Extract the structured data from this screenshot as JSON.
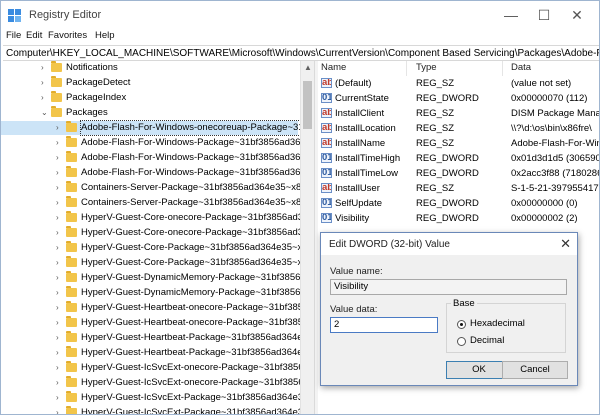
{
  "window": {
    "title": "Registry Editor"
  },
  "window_controls": {
    "minimize": "—",
    "maximize": "☐",
    "close": "✕"
  },
  "menu": [
    "File",
    "Edit",
    "Favorites",
    "Help"
  ],
  "address": "Computer\\HKEY_LOCAL_MACHINE\\SOFTWARE\\Microsoft\\Windows\\CurrentVersion\\Component Based Servicing\\Packages\\Adobe-Flash-For-Wi",
  "tree": [
    {
      "label": "Notifications",
      "level": 1,
      "arrow": "›"
    },
    {
      "label": "PackageDetect",
      "level": 1,
      "arrow": "›"
    },
    {
      "label": "PackageIndex",
      "level": 1,
      "arrow": "›"
    },
    {
      "label": "Packages",
      "level": 1,
      "arrow": "⌄"
    },
    {
      "label": "Adobe-Flash-For-Windows-onecoreuap-Package~31",
      "level": 2,
      "arrow": "›",
      "selected": true
    },
    {
      "label": "Adobe-Flash-For-Windows-Package~31bf3856ad364",
      "level": 2,
      "arrow": "›"
    },
    {
      "label": "Adobe-Flash-For-Windows-Package~31bf3856ad364",
      "level": 2,
      "arrow": "›"
    },
    {
      "label": "Adobe-Flash-For-Windows-Package~31bf3856ad364",
      "level": 2,
      "arrow": "›"
    },
    {
      "label": "Containers-Server-Package~31bf3856ad364e35~x86",
      "level": 2,
      "arrow": "›"
    },
    {
      "label": "Containers-Server-Package~31bf3856ad364e35~x86",
      "level": 2,
      "arrow": "›"
    },
    {
      "label": "HyperV-Guest-Core-onecore-Package~31bf3856ad36",
      "level": 2,
      "arrow": "›"
    },
    {
      "label": "HyperV-Guest-Core-onecore-Package~31bf3856ad36",
      "level": 2,
      "arrow": "›"
    },
    {
      "label": "HyperV-Guest-Core-Package~31bf3856ad364e35~x8t",
      "level": 2,
      "arrow": "›"
    },
    {
      "label": "HyperV-Guest-Core-Package~31bf3856ad364e35~x8t",
      "level": 2,
      "arrow": "›"
    },
    {
      "label": "HyperV-Guest-DynamicMemory-Package~31bf3856ad",
      "level": 2,
      "arrow": "›"
    },
    {
      "label": "HyperV-Guest-DynamicMemory-Package~31bf3856ad",
      "level": 2,
      "arrow": "›"
    },
    {
      "label": "HyperV-Guest-Heartbeat-onecore-Package~31bf385",
      "level": 2,
      "arrow": "›"
    },
    {
      "label": "HyperV-Guest-Heartbeat-onecore-Package~31bf385",
      "level": 2,
      "arrow": "›"
    },
    {
      "label": "HyperV-Guest-Heartbeat-Package~31bf3856ad364e3",
      "level": 2,
      "arrow": "›"
    },
    {
      "label": "HyperV-Guest-Heartbeat-Package~31bf3856ad364e3",
      "level": 2,
      "arrow": "›"
    },
    {
      "label": "HyperV-Guest-IcSvcExt-onecore-Package~31bf3856a",
      "level": 2,
      "arrow": "›"
    },
    {
      "label": "HyperV-Guest-IcSvcExt-onecore-Package~31bf3856a",
      "level": 2,
      "arrow": "›"
    },
    {
      "label": "HyperV-Guest-IcSvcExt-Package~31bf3856ad364e35",
      "level": 2,
      "arrow": "›"
    },
    {
      "label": "HyperV-Guest-IcSvcExt-Package~31bf3856ad364e35",
      "level": 2,
      "arrow": "›"
    }
  ],
  "list": {
    "headers": [
      "Name",
      "Type",
      "Data"
    ],
    "rows": [
      {
        "name": "(Default)",
        "type": "REG_SZ",
        "data": "(value not set)",
        "icon": "string-value-icon"
      },
      {
        "name": "CurrentState",
        "type": "REG_DWORD",
        "data": "0x00000070 (112)",
        "icon": "binary-value-icon"
      },
      {
        "name": "InstallClient",
        "type": "REG_SZ",
        "data": "DISM Package Manag",
        "icon": "string-value-icon"
      },
      {
        "name": "InstallLocation",
        "type": "REG_SZ",
        "data": "\\\\?\\d:\\os\\bin\\x86fre\\",
        "icon": "string-value-icon"
      },
      {
        "name": "InstallName",
        "type": "REG_SZ",
        "data": "Adobe-Flash-For-Win",
        "icon": "string-value-icon"
      },
      {
        "name": "InstallTimeHigh",
        "type": "REG_DWORD",
        "data": "0x01d3d1d5 (306590",
        "icon": "binary-value-icon"
      },
      {
        "name": "InstallTimeLow",
        "type": "REG_DWORD",
        "data": "0x2acc3f88 (7180286",
        "icon": "binary-value-icon"
      },
      {
        "name": "InstallUser",
        "type": "REG_SZ",
        "data": "S-1-5-21-397955417",
        "icon": "string-value-icon"
      },
      {
        "name": "SelfUpdate",
        "type": "REG_DWORD",
        "data": "0x00000000 (0)",
        "icon": "binary-value-icon"
      },
      {
        "name": "Visibility",
        "type": "REG_DWORD",
        "data": "0x00000002 (2)",
        "icon": "binary-value-icon"
      }
    ]
  },
  "dialog": {
    "title": "Edit DWORD (32-bit) Value",
    "close": "✕",
    "value_name_label": "Value name:",
    "value_name": "Visibility",
    "value_data_label": "Value data:",
    "value_data": "2",
    "base_label": "Base",
    "hex_label": "Hexadecimal",
    "dec_label": "Decimal",
    "hex_selected": true,
    "ok_label": "OK",
    "cancel_label": "Cancel"
  },
  "colors": {
    "accent": "#0078d7",
    "folder": "#f2c54a",
    "selection": "#cce4f7"
  }
}
